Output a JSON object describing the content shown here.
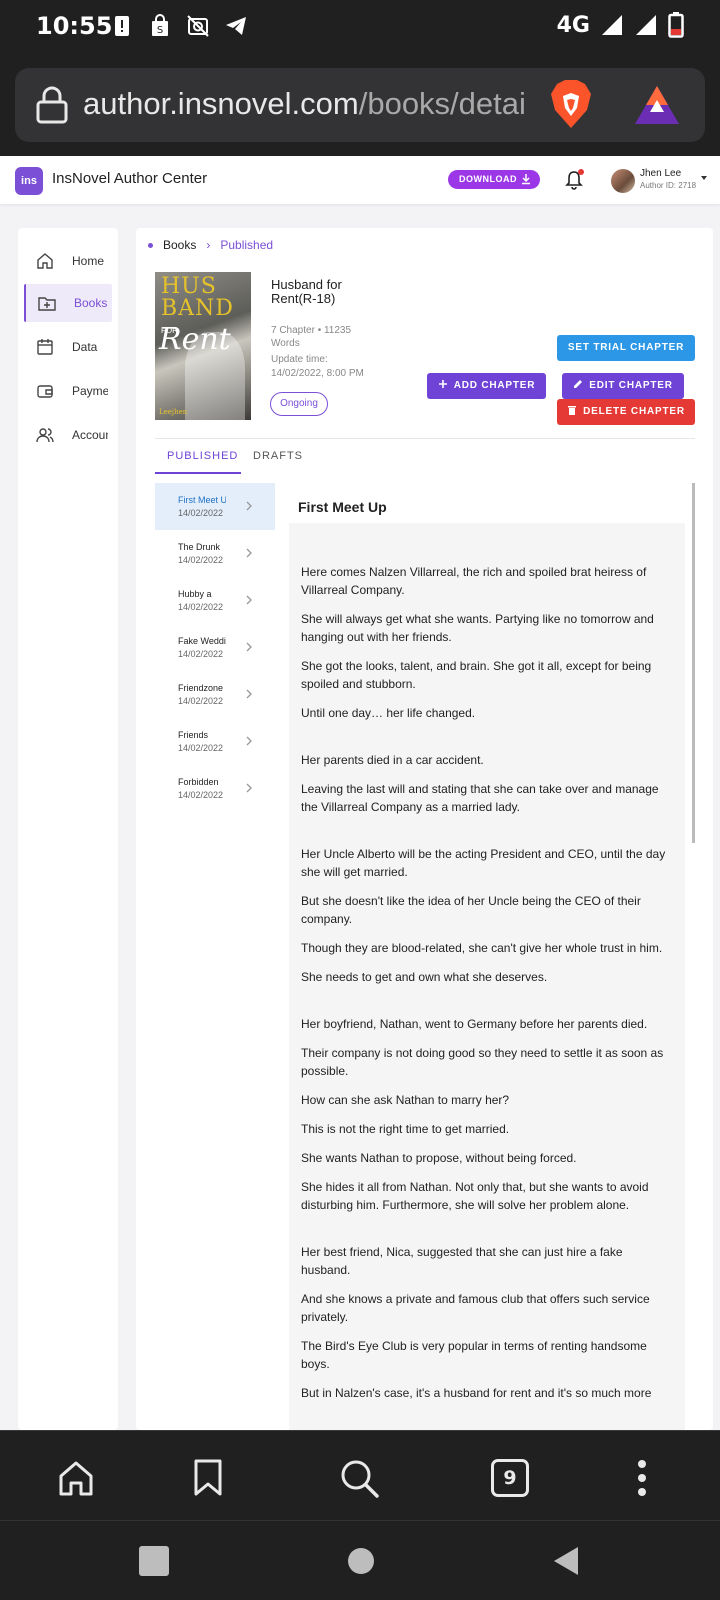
{
  "status_bar": {
    "time": "10:55",
    "network": "4G"
  },
  "browser": {
    "url_host": "author.insnovel.com",
    "url_path": "/books/detai",
    "tab_count": "9"
  },
  "app": {
    "logo_text": "ins",
    "title": "InsNovel Author Center",
    "download_label": "DOWNLOAD",
    "user_name": "Jhen Lee",
    "author_id": "Author ID: 2718"
  },
  "sidebar": {
    "items": [
      {
        "label": "Home",
        "icon": "home-icon",
        "active": false
      },
      {
        "label": "Books",
        "icon": "folder-icon",
        "active": true
      },
      {
        "label": "Data",
        "icon": "calendar-icon",
        "active": false
      },
      {
        "label": "Payment",
        "icon": "wallet-icon",
        "active": false
      },
      {
        "label": "Account",
        "icon": "people-icon",
        "active": false
      }
    ]
  },
  "breadcrumb": {
    "root": "Books",
    "current": "Published"
  },
  "book": {
    "cover_title_1": "HUS",
    "cover_title_2": "BAND",
    "cover_title_3": "FOR",
    "cover_title_4": "Rent",
    "cover_author": "Leejhen",
    "title": "Husband for Rent(R-18)",
    "meta": "7 Chapter • 11235 Words",
    "update_label": "Update time:",
    "update_time": "14/02/2022, 8:00 PM",
    "status": "Ongoing"
  },
  "actions": {
    "trial": "SET TRIAL CHAPTER",
    "add": "ADD CHAPTER",
    "edit": "EDIT CHAPTER",
    "delete": "DELETE CHAPTER"
  },
  "tabs": {
    "published": "PUBLISHED",
    "drafts": "DRAFTS"
  },
  "chapters": [
    {
      "title": "First Meet Up",
      "date": "14/02/2022"
    },
    {
      "title": "The Drunk",
      "date": "14/02/2022"
    },
    {
      "title": "Hubby a",
      "date": "14/02/2022"
    },
    {
      "title": "Fake Wedding",
      "date": "14/02/2022"
    },
    {
      "title": "Friendzone",
      "date": "14/02/2022"
    },
    {
      "title": "Friends",
      "date": "14/02/2022"
    },
    {
      "title": "Forbidden",
      "date": "14/02/2022"
    }
  ],
  "chapter_view": {
    "title": "First Meet Up",
    "paragraphs": [
      "Here comes Nalzen Villarreal, the rich and spoiled brat heiress of Villarreal Company.",
      "She will always get what she wants. Partying like no tomorrow and hanging out with her friends.",
      "She got the looks, talent, and brain. She got it all, except for being spoiled and stubborn.",
      "Until one day… her life changed.",
      "Her parents died in a car accident.",
      "Leaving the last will and stating that she can take over and manage the Villarreal Company as a married lady.",
      "Her Uncle Alberto will be the acting President and CEO, until the day she will get married.",
      "But she doesn't like the idea of her Uncle being the CEO of their company.",
      "Though they are blood-related, she can't give her whole trust in him.",
      "She needs to get and own what she deserves.",
      "Her boyfriend, Nathan, went to Germany before her parents died.",
      "Their company is not doing good so they need to settle it as soon as possible.",
      "How can she ask Nathan to marry her?",
      "This is not the right time to get married.",
      "She wants Nathan to propose, without being forced.",
      "She hides it all from Nathan. Not only that, but she wants to avoid disturbing him. Furthermore, she will solve her problem alone.",
      "Her best friend, Nica, suggested that she can just hire a fake husband.",
      "And she knows a private and famous club that offers such service privately.",
      "The Bird's Eye Club is very popular in terms of renting handsome boys.",
      "But in Nalzen's case, it's a husband for rent and it's so much more"
    ]
  },
  "colors": {
    "accent": "#6f43d6",
    "trial": "#2b97e6",
    "danger": "#e53935",
    "download": "#9b37e6"
  }
}
